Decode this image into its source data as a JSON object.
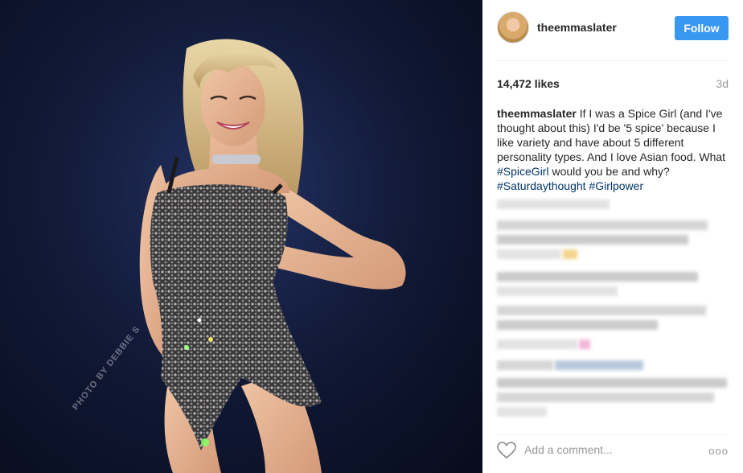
{
  "photo": {
    "watermark": "PHOTO BY DEBBIE S"
  },
  "header": {
    "username": "theemmaslater",
    "follow_label": "Follow",
    "avatar_icon": "profile-avatar"
  },
  "stats": {
    "likes": "14,472 likes",
    "age": "3d"
  },
  "caption": {
    "user": "theemmaslater",
    "text": " If I was a Spice Girl (and I've thought about this) I'd be '5 spice' because I like variety and have about 5 different personality types. And I love Asian food. What ",
    "tag1": "#SpiceGirl",
    "text2": " would you be and why?",
    "tag2": "#Saturdaythought",
    "tag3": "#Girlpower"
  },
  "comment_box": {
    "placeholder": "Add a comment...",
    "more_label": "ooo"
  },
  "colors": {
    "follow_bg": "#3897f0",
    "hashtag": "#003569",
    "muted": "#999999"
  }
}
